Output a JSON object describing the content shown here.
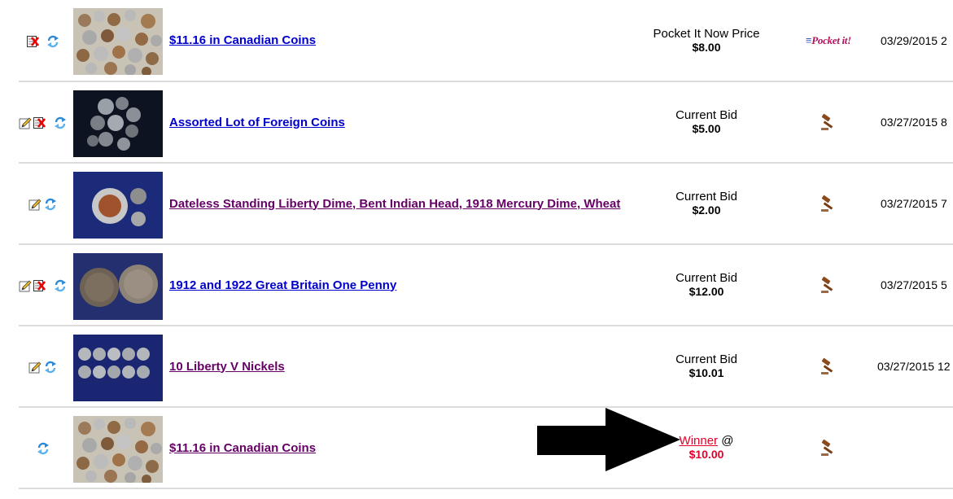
{
  "rows": [
    {
      "title": "$11.16 in Canadian Coins",
      "price_label": "Pocket It Now Price",
      "price_value": "$8.00",
      "action": "Pocket it!",
      "date": "03/29/2015 2",
      "icons": [
        "delete-icon",
        "relist-icon"
      ],
      "thumb": "canadian-coins-photo",
      "style": "link"
    },
    {
      "title": "Assorted Lot of Foreign Coins",
      "price_label": "Current Bid",
      "price_value": "$5.00",
      "action": "gavel-icon",
      "date": "03/27/2015 8",
      "icons": [
        "edit-icon",
        "delete-icon",
        "relist-icon"
      ],
      "thumb": "foreign-coins-photo",
      "style": "link"
    },
    {
      "title": "Dateless Standing Liberty Dime, Bent Indian Head, 1918 Mercury Dime, Wheat",
      "price_label": "Current Bid",
      "price_value": "$2.00",
      "action": "gavel-icon",
      "date": "03/27/2015 7",
      "icons": [
        "edit-icon",
        "relist-icon"
      ],
      "thumb": "liberty-dime-photo",
      "style": "visited"
    },
    {
      "title": "1912 and 1922 Great Britain One Penny",
      "price_label": "Current Bid",
      "price_value": "$12.00",
      "action": "gavel-icon",
      "date": "03/27/2015 5",
      "icons": [
        "edit-icon",
        "delete-icon",
        "relist-icon"
      ],
      "thumb": "penny-photo",
      "style": "link"
    },
    {
      "title": "10 Liberty V Nickels",
      "price_label": "Current Bid",
      "price_value": "$10.01",
      "action": "gavel-icon",
      "date": "03/27/2015 12",
      "icons": [
        "edit-icon",
        "relist-icon"
      ],
      "thumb": "nickels-photo",
      "style": "visited"
    },
    {
      "title": "$11.16 in Canadian Coins",
      "winner_label": "Winner",
      "winner_at": "@",
      "price_value": "$10.00",
      "action": "gavel-icon",
      "date": "",
      "icons": [
        "relist-icon"
      ],
      "thumb": "canadian-coins-photo",
      "style": "visited"
    }
  ],
  "colors": {
    "link": "#0000cc",
    "visited": "#660066",
    "winner": "#e4002b",
    "divider": "#dcdcdc"
  }
}
